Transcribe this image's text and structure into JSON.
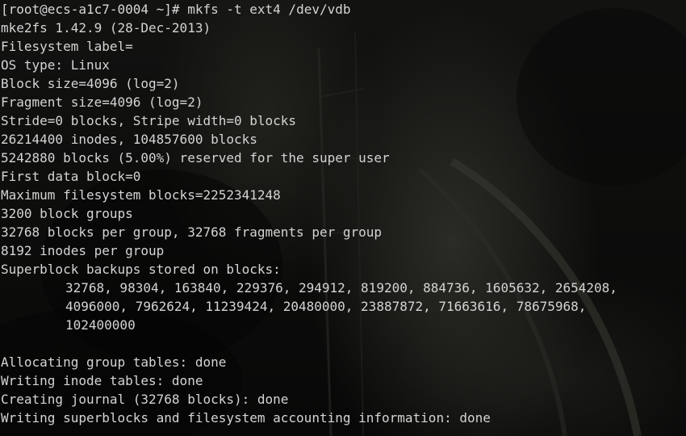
{
  "terminal": {
    "prompt": "[root@ecs-a1c7-0004 ~]#",
    "command": "mkfs -t ext4 /dev/vdb",
    "output": [
      "mke2fs 1.42.9 (28-Dec-2013)",
      "Filesystem label=",
      "OS type: Linux",
      "Block size=4096 (log=2)",
      "Fragment size=4096 (log=2)",
      "Stride=0 blocks, Stripe width=0 blocks",
      "26214400 inodes, 104857600 blocks",
      "5242880 blocks (5.00%) reserved for the super user",
      "First data block=0",
      "Maximum filesystem blocks=2252341248",
      "3200 block groups",
      "32768 blocks per group, 32768 fragments per group",
      "8192 inodes per group",
      "Superblock backups stored on blocks:"
    ],
    "backup_blocks": [
      "32768, 98304, 163840, 229376, 294912, 819200, 884736, 1605632, 2654208,",
      "4096000, 7962624, 11239424, 20480000, 23887872, 71663616, 78675968,",
      "102400000"
    ],
    "progress": [
      "Allocating group tables: done",
      "Writing inode tables: done",
      "Creating journal (32768 blocks): done",
      "Writing superblocks and filesystem accounting information: done"
    ]
  }
}
